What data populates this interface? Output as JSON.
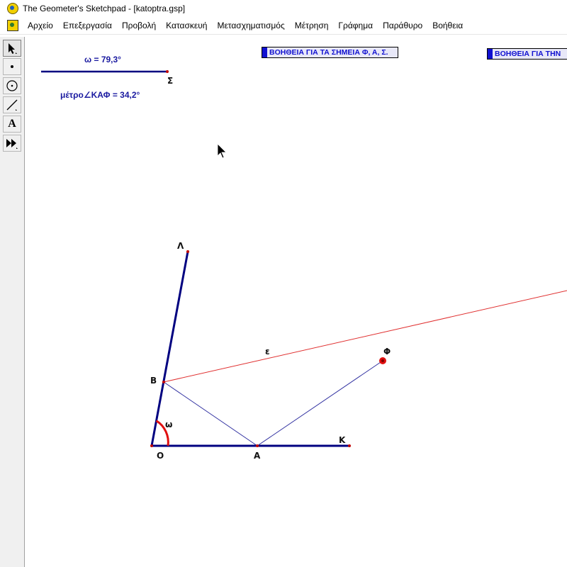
{
  "window": {
    "title": "The Geometer's Sketchpad - [katoptra.gsp]"
  },
  "menu": {
    "items": [
      "Αρχείο",
      "Επεξεργασία",
      "Προβολή",
      "Κατασκευή",
      "Μετασχηματισμός",
      "Μέτρηση",
      "Γράφημα",
      "Παράθυρο",
      "Βοήθεια"
    ]
  },
  "toolbox": {
    "tools": [
      "selection-arrow-icon",
      "point-icon",
      "compass-icon",
      "straightedge-icon",
      "text-icon",
      "custom-tool-icon"
    ],
    "text_tool_glyph": "A"
  },
  "canvas": {
    "measurements": {
      "omega": "ω = 79,3°",
      "angle_KAF": "μέτρο∠ΚΑΦ = 34,2°"
    },
    "help_buttons": {
      "points": "ΒΟΗΘΕΙΑ ΓΙΑ ΤΑ ΣΗΜΕΙΑ Φ, Α, Σ.",
      "other": "ΒΟΗΘΕΙΑ ΓΙΑ ΤΗΝ"
    },
    "labels": {
      "sigma": "Σ",
      "lambda": "Λ",
      "b": "Β",
      "epsilon": "ε",
      "phi": "Φ",
      "omega": "ω",
      "o": "Ο",
      "a": "Α",
      "k": "Κ"
    },
    "colors": {
      "segment": "#000080",
      "ray": "#e03030",
      "thin_line": "#3030a0",
      "arc": "#e01010",
      "point": "#c00000"
    }
  }
}
